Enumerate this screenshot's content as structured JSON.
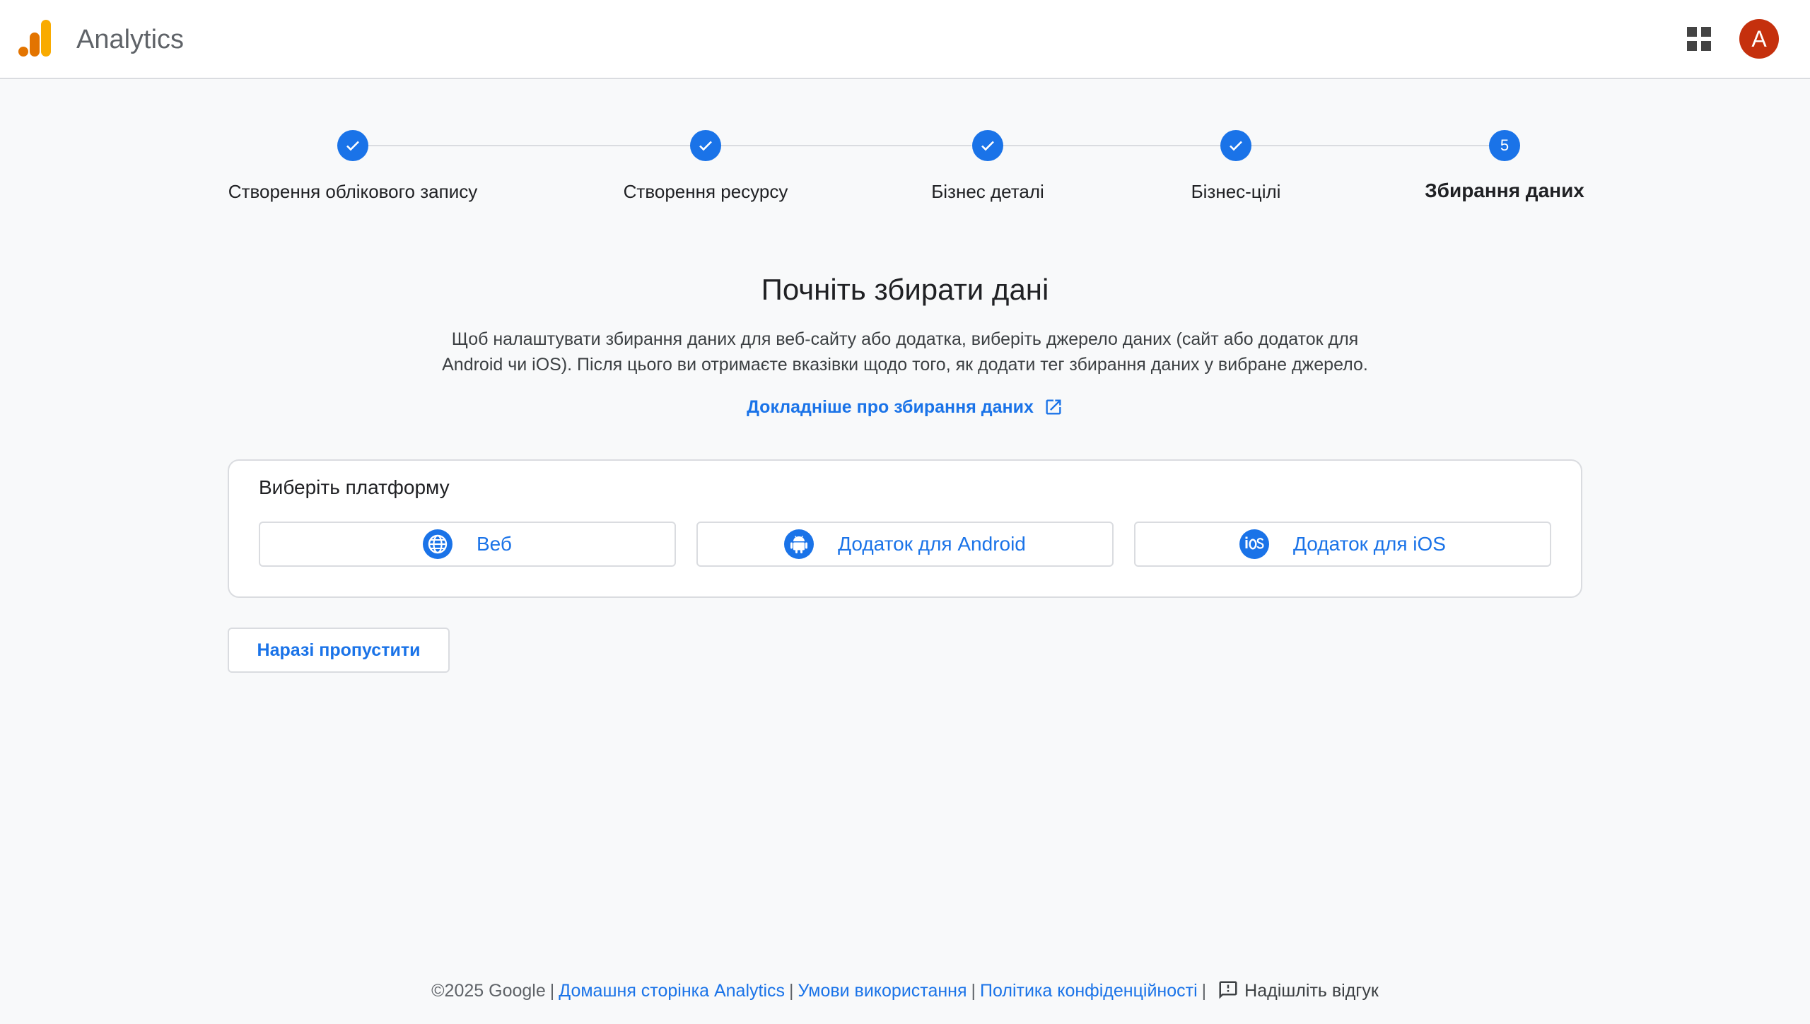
{
  "header": {
    "app_title": "Analytics",
    "avatar_initial": "A",
    "icons": {
      "logo": "analytics-logo",
      "apps": "apps-grid-icon"
    }
  },
  "stepper": {
    "current_step": 5,
    "steps": [
      {
        "label": "Створення облікового запису",
        "state": "done"
      },
      {
        "label": "Створення ресурсу",
        "state": "done"
      },
      {
        "label": "Бізнес деталі",
        "state": "done"
      },
      {
        "label": "Бізнес-цілі",
        "state": "done"
      },
      {
        "label": "Збирання даних",
        "state": "active",
        "number": "5"
      }
    ]
  },
  "main": {
    "title": "Почніть збирати дані",
    "description_line1": "Щоб налаштувати збирання даних для веб-сайту або додатка, виберіть джерело даних (сайт або додаток для",
    "description_line2": "Android чи iOS). Після цього ви отримаєте вказівки щодо того, як додати тег збирання даних у вибране джерело.",
    "learn_more": "Докладніше про збирання даних"
  },
  "platform": {
    "heading": "Виберіть платформу",
    "options": [
      {
        "label": "Веб",
        "icon": "globe-icon"
      },
      {
        "label": "Додаток для Android",
        "icon": "android-icon"
      },
      {
        "label": "Додаток для iOS",
        "icon": "ios-icon"
      }
    ]
  },
  "actions": {
    "skip_label": "Наразі пропустити"
  },
  "footer": {
    "copyright": "©2025 Google",
    "links": [
      "Домашня сторінка Analytics",
      "Умови використання",
      "Політика конфіденційності"
    ],
    "feedback": "Надішліть відгук"
  },
  "colors": {
    "accent": "#1a73e8",
    "avatar": "#c5300d",
    "logo_orange": "#f9ab00",
    "logo_dark_orange": "#e37400"
  }
}
